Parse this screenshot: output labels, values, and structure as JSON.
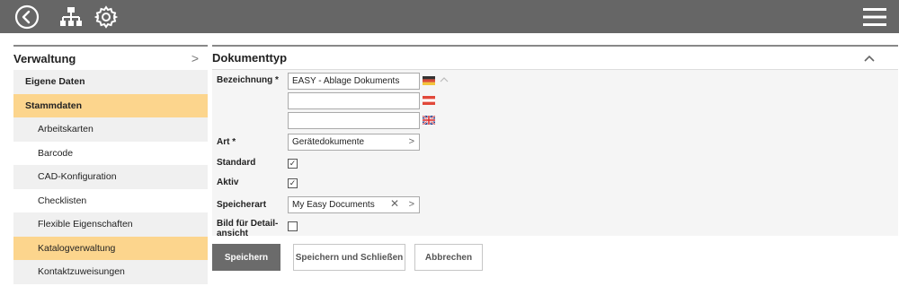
{
  "topbar": {
    "icons": [
      "back-circle-icon",
      "sitemap-icon",
      "gear-icon",
      "hamburger-menu-icon"
    ]
  },
  "sidebar": {
    "title": "Verwaltung",
    "items": [
      {
        "label": "Eigene Daten"
      },
      {
        "label": "Stammdaten"
      },
      {
        "label": "Arbeitskarten"
      },
      {
        "label": "Barcode"
      },
      {
        "label": "CAD-Konfiguration"
      },
      {
        "label": "Checklisten"
      },
      {
        "label": "Flexible Eigenschaften"
      },
      {
        "label": "Katalogverwaltung"
      },
      {
        "label": "Kontaktzuweisungen"
      }
    ]
  },
  "main": {
    "title": "Dokumenttyp",
    "form": {
      "bezeichnung_label": "Bezeichnung *",
      "bezeichnung_de": "EASY - Ablage Dokuments",
      "bezeichnung_at": "",
      "bezeichnung_en": "",
      "art_label": "Art *",
      "art_value": "Gerätedokumente",
      "standard_label": "Standard",
      "standard_checked": true,
      "aktiv_label": "Aktiv",
      "aktiv_checked": true,
      "speicherart_label": "Speicherart",
      "speicherart_value": "My Easy Documents",
      "bild_label_line1": "Bild für Detail-",
      "bild_label_line2": "ansicht",
      "bild_checked": false
    },
    "buttons": {
      "save": "Speichern",
      "save_close": "Speichern und Schließen",
      "cancel": "Abbrechen"
    }
  },
  "colors": {
    "topbar": "#666666",
    "accent": "#fcd58d",
    "primary_button": "#6b6b6b"
  }
}
